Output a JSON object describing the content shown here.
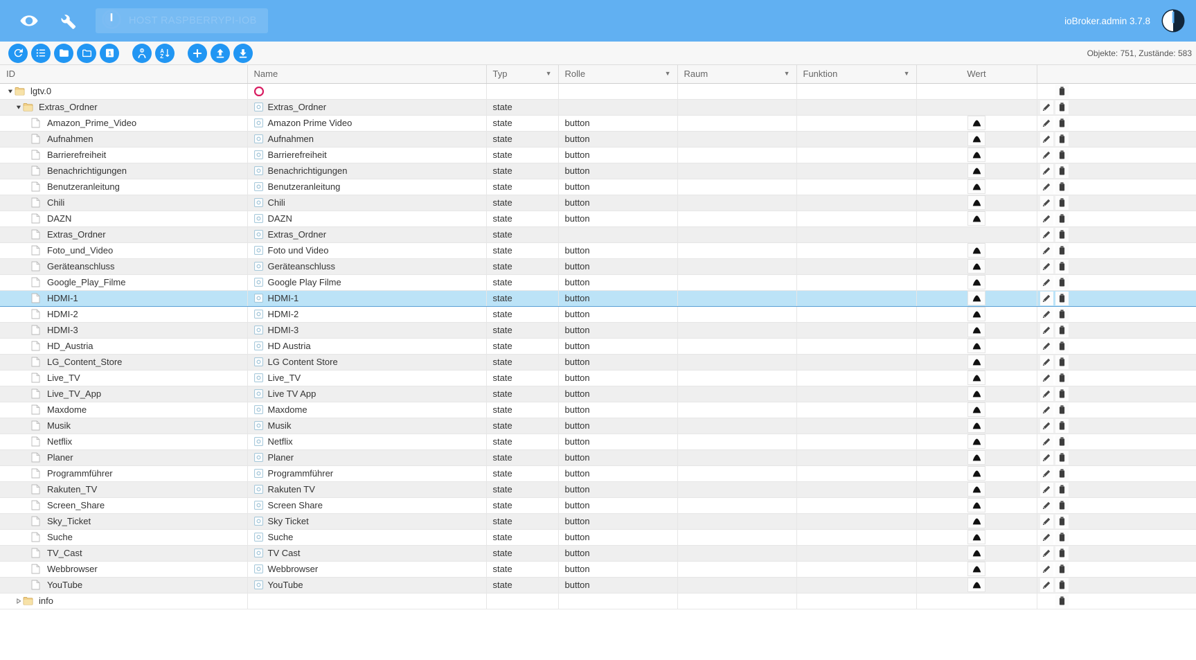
{
  "appbar": {
    "eye_icon": "eye-icon",
    "wrench_icon": "wrench-icon",
    "host_label": "HOST RASPBERRYPI-IOB",
    "host_power_icon": "power-icon",
    "version": "ioBroker.admin 3.7.8",
    "logo_icon": "iobroker-logo-icon",
    "bg_color": "#61b0f2"
  },
  "toolbar": {
    "buttons": [
      {
        "name": "refresh-button",
        "icon": "refresh-icon",
        "title": "Aktualisieren"
      },
      {
        "name": "list-button",
        "icon": "list-icon",
        "title": "Liste"
      },
      {
        "name": "expand-all-button",
        "icon": "folder-open-icon",
        "title": "Alle ausklappen"
      },
      {
        "name": "collapse-all-button",
        "icon": "folder-icon",
        "title": "Alle einklappen"
      },
      {
        "name": "depth-level-button",
        "icon": "number-one-icon",
        "title": "Ebene",
        "label": "1"
      },
      {
        "name": "expert-mode-button",
        "icon": "expert-icon",
        "title": "Expertenmodus"
      },
      {
        "name": "sort-button",
        "icon": "sort-az-icon",
        "title": "Sortieren A-Z"
      },
      {
        "name": "add-object-button",
        "icon": "plus-icon",
        "title": "Objekt hinzufügen"
      },
      {
        "name": "upload-button",
        "icon": "upload-icon",
        "title": "Hochladen"
      },
      {
        "name": "download-button",
        "icon": "download-icon",
        "title": "Herunterladen"
      }
    ],
    "counters": "Objekte: 751, Zustände: 583"
  },
  "table": {
    "columns": [
      {
        "key": "id",
        "label": "ID",
        "filter": false
      },
      {
        "key": "name",
        "label": "Name",
        "filter": false
      },
      {
        "key": "typ",
        "label": "Typ",
        "filter": true
      },
      {
        "key": "rolle",
        "label": "Rolle",
        "filter": true
      },
      {
        "key": "raum",
        "label": "Raum",
        "filter": true
      },
      {
        "key": "funktion",
        "label": "Funktion",
        "filter": true
      },
      {
        "key": "wert",
        "label": "Wert",
        "filter": false
      },
      {
        "key": "actions",
        "label": "",
        "filter": false
      }
    ],
    "rows": [
      {
        "id": "lgtv.0",
        "indent": 0,
        "kind": "folder",
        "expanded": true,
        "icon": "folder-icon",
        "name": "",
        "name_icon": "magenta-circle-icon",
        "typ": "",
        "rolle": "",
        "wert": false,
        "edit": false,
        "del": true,
        "selected": false
      },
      {
        "id": "Extras_Ordner",
        "indent": 1,
        "kind": "folder",
        "expanded": true,
        "icon": "folder-icon",
        "name": "Extras_Ordner",
        "name_icon": "state-icon",
        "typ": "state",
        "rolle": "",
        "wert": false,
        "edit": true,
        "del": true,
        "selected": false
      },
      {
        "id": "Amazon_Prime_Video",
        "indent": 2,
        "kind": "state",
        "expanded": false,
        "icon": "file-icon",
        "name": "Amazon Prime Video",
        "name_icon": "state-icon",
        "typ": "state",
        "rolle": "button",
        "wert": true,
        "edit": true,
        "del": true,
        "selected": false
      },
      {
        "id": "Aufnahmen",
        "indent": 2,
        "kind": "state",
        "expanded": false,
        "icon": "file-icon",
        "name": "Aufnahmen",
        "name_icon": "state-icon",
        "typ": "state",
        "rolle": "button",
        "wert": true,
        "edit": true,
        "del": true,
        "selected": false
      },
      {
        "id": "Barrierefreiheit",
        "indent": 2,
        "kind": "state",
        "expanded": false,
        "icon": "file-icon",
        "name": "Barrierefreiheit",
        "name_icon": "state-icon",
        "typ": "state",
        "rolle": "button",
        "wert": true,
        "edit": true,
        "del": true,
        "selected": false
      },
      {
        "id": "Benachrichtigungen",
        "indent": 2,
        "kind": "state",
        "expanded": false,
        "icon": "file-icon",
        "name": "Benachrichtigungen",
        "name_icon": "state-icon",
        "typ": "state",
        "rolle": "button",
        "wert": true,
        "edit": true,
        "del": true,
        "selected": false
      },
      {
        "id": "Benutzeranleitung",
        "indent": 2,
        "kind": "state",
        "expanded": false,
        "icon": "file-icon",
        "name": "Benutzeranleitung",
        "name_icon": "state-icon",
        "typ": "state",
        "rolle": "button",
        "wert": true,
        "edit": true,
        "del": true,
        "selected": false
      },
      {
        "id": "Chili",
        "indent": 2,
        "kind": "state",
        "expanded": false,
        "icon": "file-icon",
        "name": "Chili",
        "name_icon": "state-icon",
        "typ": "state",
        "rolle": "button",
        "wert": true,
        "edit": true,
        "del": true,
        "selected": false
      },
      {
        "id": "DAZN",
        "indent": 2,
        "kind": "state",
        "expanded": false,
        "icon": "file-icon",
        "name": "DAZN",
        "name_icon": "state-icon",
        "typ": "state",
        "rolle": "button",
        "wert": true,
        "edit": true,
        "del": true,
        "selected": false
      },
      {
        "id": "Extras_Ordner",
        "indent": 2,
        "kind": "state",
        "expanded": false,
        "icon": "file-icon",
        "name": "Extras_Ordner",
        "name_icon": "state-icon",
        "typ": "state",
        "rolle": "",
        "wert": false,
        "edit": true,
        "del": true,
        "selected": false
      },
      {
        "id": "Foto_und_Video",
        "indent": 2,
        "kind": "state",
        "expanded": false,
        "icon": "file-icon",
        "name": "Foto und Video",
        "name_icon": "state-icon",
        "typ": "state",
        "rolle": "button",
        "wert": true,
        "edit": true,
        "del": true,
        "selected": false
      },
      {
        "id": "Geräteanschluss",
        "indent": 2,
        "kind": "state",
        "expanded": false,
        "icon": "file-icon",
        "name": "Geräteanschluss",
        "name_icon": "state-icon",
        "typ": "state",
        "rolle": "button",
        "wert": true,
        "edit": true,
        "del": true,
        "selected": false
      },
      {
        "id": "Google_Play_Filme",
        "indent": 2,
        "kind": "state",
        "expanded": false,
        "icon": "file-icon",
        "name": "Google Play Filme",
        "name_icon": "state-icon",
        "typ": "state",
        "rolle": "button",
        "wert": true,
        "edit": true,
        "del": true,
        "selected": false
      },
      {
        "id": "HDMI-1",
        "indent": 2,
        "kind": "state",
        "expanded": false,
        "icon": "file-icon",
        "name": "HDMI-1",
        "name_icon": "state-icon",
        "typ": "state",
        "rolle": "button",
        "wert": true,
        "edit": true,
        "del": true,
        "selected": true
      },
      {
        "id": "HDMI-2",
        "indent": 2,
        "kind": "state",
        "expanded": false,
        "icon": "file-icon",
        "name": "HDMI-2",
        "name_icon": "state-icon",
        "typ": "state",
        "rolle": "button",
        "wert": true,
        "edit": true,
        "del": true,
        "selected": false
      },
      {
        "id": "HDMI-3",
        "indent": 2,
        "kind": "state",
        "expanded": false,
        "icon": "file-icon",
        "name": "HDMI-3",
        "name_icon": "state-icon",
        "typ": "state",
        "rolle": "button",
        "wert": true,
        "edit": true,
        "del": true,
        "selected": false
      },
      {
        "id": "HD_Austria",
        "indent": 2,
        "kind": "state",
        "expanded": false,
        "icon": "file-icon",
        "name": "HD Austria",
        "name_icon": "state-icon",
        "typ": "state",
        "rolle": "button",
        "wert": true,
        "edit": true,
        "del": true,
        "selected": false
      },
      {
        "id": "LG_Content_Store",
        "indent": 2,
        "kind": "state",
        "expanded": false,
        "icon": "file-icon",
        "name": "LG Content Store",
        "name_icon": "state-icon",
        "typ": "state",
        "rolle": "button",
        "wert": true,
        "edit": true,
        "del": true,
        "selected": false
      },
      {
        "id": "Live_TV",
        "indent": 2,
        "kind": "state",
        "expanded": false,
        "icon": "file-icon",
        "name": "Live_TV",
        "name_icon": "state-icon",
        "typ": "state",
        "rolle": "button",
        "wert": true,
        "edit": true,
        "del": true,
        "selected": false
      },
      {
        "id": "Live_TV_App",
        "indent": 2,
        "kind": "state",
        "expanded": false,
        "icon": "file-icon",
        "name": "Live TV App",
        "name_icon": "state-icon",
        "typ": "state",
        "rolle": "button",
        "wert": true,
        "edit": true,
        "del": true,
        "selected": false
      },
      {
        "id": "Maxdome",
        "indent": 2,
        "kind": "state",
        "expanded": false,
        "icon": "file-icon",
        "name": "Maxdome",
        "name_icon": "state-icon",
        "typ": "state",
        "rolle": "button",
        "wert": true,
        "edit": true,
        "del": true,
        "selected": false
      },
      {
        "id": "Musik",
        "indent": 2,
        "kind": "state",
        "expanded": false,
        "icon": "file-icon",
        "name": "Musik",
        "name_icon": "state-icon",
        "typ": "state",
        "rolle": "button",
        "wert": true,
        "edit": true,
        "del": true,
        "selected": false
      },
      {
        "id": "Netflix",
        "indent": 2,
        "kind": "state",
        "expanded": false,
        "icon": "file-icon",
        "name": "Netflix",
        "name_icon": "state-icon",
        "typ": "state",
        "rolle": "button",
        "wert": true,
        "edit": true,
        "del": true,
        "selected": false
      },
      {
        "id": "Planer",
        "indent": 2,
        "kind": "state",
        "expanded": false,
        "icon": "file-icon",
        "name": "Planer",
        "name_icon": "state-icon",
        "typ": "state",
        "rolle": "button",
        "wert": true,
        "edit": true,
        "del": true,
        "selected": false
      },
      {
        "id": "Programmführer",
        "indent": 2,
        "kind": "state",
        "expanded": false,
        "icon": "file-icon",
        "name": "Programmführer",
        "name_icon": "state-icon",
        "typ": "state",
        "rolle": "button",
        "wert": true,
        "edit": true,
        "del": true,
        "selected": false
      },
      {
        "id": "Rakuten_TV",
        "indent": 2,
        "kind": "state",
        "expanded": false,
        "icon": "file-icon",
        "name": "Rakuten TV",
        "name_icon": "state-icon",
        "typ": "state",
        "rolle": "button",
        "wert": true,
        "edit": true,
        "del": true,
        "selected": false
      },
      {
        "id": "Screen_Share",
        "indent": 2,
        "kind": "state",
        "expanded": false,
        "icon": "file-icon",
        "name": "Screen Share",
        "name_icon": "state-icon",
        "typ": "state",
        "rolle": "button",
        "wert": true,
        "edit": true,
        "del": true,
        "selected": false
      },
      {
        "id": "Sky_Ticket",
        "indent": 2,
        "kind": "state",
        "expanded": false,
        "icon": "file-icon",
        "name": "Sky Ticket",
        "name_icon": "state-icon",
        "typ": "state",
        "rolle": "button",
        "wert": true,
        "edit": true,
        "del": true,
        "selected": false
      },
      {
        "id": "Suche",
        "indent": 2,
        "kind": "state",
        "expanded": false,
        "icon": "file-icon",
        "name": "Suche",
        "name_icon": "state-icon",
        "typ": "state",
        "rolle": "button",
        "wert": true,
        "edit": true,
        "del": true,
        "selected": false
      },
      {
        "id": "TV_Cast",
        "indent": 2,
        "kind": "state",
        "expanded": false,
        "icon": "file-icon",
        "name": "TV Cast",
        "name_icon": "state-icon",
        "typ": "state",
        "rolle": "button",
        "wert": true,
        "edit": true,
        "del": true,
        "selected": false
      },
      {
        "id": "Webbrowser",
        "indent": 2,
        "kind": "state",
        "expanded": false,
        "icon": "file-icon",
        "name": "Webbrowser",
        "name_icon": "state-icon",
        "typ": "state",
        "rolle": "button",
        "wert": true,
        "edit": true,
        "del": true,
        "selected": false
      },
      {
        "id": "YouTube",
        "indent": 2,
        "kind": "state",
        "expanded": false,
        "icon": "file-icon",
        "name": "YouTube",
        "name_icon": "state-icon",
        "typ": "state",
        "rolle": "button",
        "wert": true,
        "edit": true,
        "del": true,
        "selected": false
      },
      {
        "id": "info",
        "indent": 1,
        "kind": "folder",
        "expanded": false,
        "icon": "folder-icon",
        "name": "",
        "name_icon": "",
        "typ": "",
        "rolle": "",
        "wert": false,
        "edit": false,
        "del": true,
        "selected": false
      }
    ]
  },
  "colors": {
    "accent": "#61b0f2",
    "button_blue": "#2196f3",
    "selected_row": "#bce3f7",
    "alt_row": "#efefef",
    "magenta": "#d81b60"
  }
}
